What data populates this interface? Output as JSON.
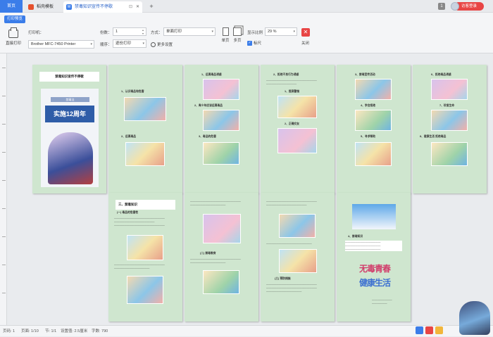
{
  "tabs": {
    "home": "首页",
    "items": [
      {
        "label": "稻壳模板",
        "icon": "docer-icon"
      },
      {
        "label": "禁毒知识宣传不停歇",
        "icon": "doc-icon",
        "icon_text": "W"
      }
    ],
    "new_tab": "+",
    "notif_count": "1",
    "login": "访客登录"
  },
  "toolbar": {
    "print_preview_tab": "打印预览",
    "direct_print": "直接打印",
    "printer_label": "打印机：",
    "printer_value": "Brother MFC-7450 Printer",
    "copies_label": "份数：",
    "copies_value": "1",
    "order_label": "顺序：",
    "order_value": "逐份打印",
    "mode_label": "方式：",
    "mode_value": "单面打印",
    "more_settings": "更多设置",
    "single_page": "单页",
    "multi_page": "多页",
    "zoom_label": "显示比例",
    "zoom_value": "29 %",
    "ruler": "标尺",
    "ruler_checked": true,
    "close": "关闭"
  },
  "pages": [
    {
      "title": "禁毒知识宣传不停歇",
      "cover_banner": "实施12周年",
      "cover_tag": "禁毒法"
    },
    {
      "title": "",
      "captions": [
        "1、认识毒品和危害",
        "2、远离毒品"
      ]
    },
    {
      "title": "1、远离毒品诱惑",
      "captions": [
        "2、青少年应该远离毒品",
        "3、毒品的危害"
      ]
    },
    {
      "title": "2、拒绝不良行为诱惑",
      "captions": [
        "1、提高警惕",
        "2、正确交友"
      ]
    },
    {
      "title": "3、禁毒宣传活动",
      "captions": [
        "4、学会拒绝",
        "5、寻求帮助"
      ]
    },
    {
      "title": "6、拒绝毒品诱惑",
      "captions": [
        "7、珍爱生命",
        "8、健康生活 拒绝毒品"
      ]
    },
    {
      "title": "三、禁毒知识",
      "captions": [
        "(一) 毒品的危害性"
      ]
    },
    {
      "title": "",
      "captions": [
        "(二) 禁毒教育"
      ]
    },
    {
      "title": "",
      "captions": [
        "(三) 预防措施"
      ]
    },
    {
      "title": "",
      "captions": [
        "4、禁毒知识"
      ],
      "calligraphy_a": "无毒青春",
      "calligraphy_b": "健康生活"
    }
  ],
  "status": {
    "page": "页码: 1",
    "pages": "页面: 1/10",
    "section": "节: 1/1",
    "setting": "设置值: 2.5厘米",
    "words": "字数: 790"
  }
}
